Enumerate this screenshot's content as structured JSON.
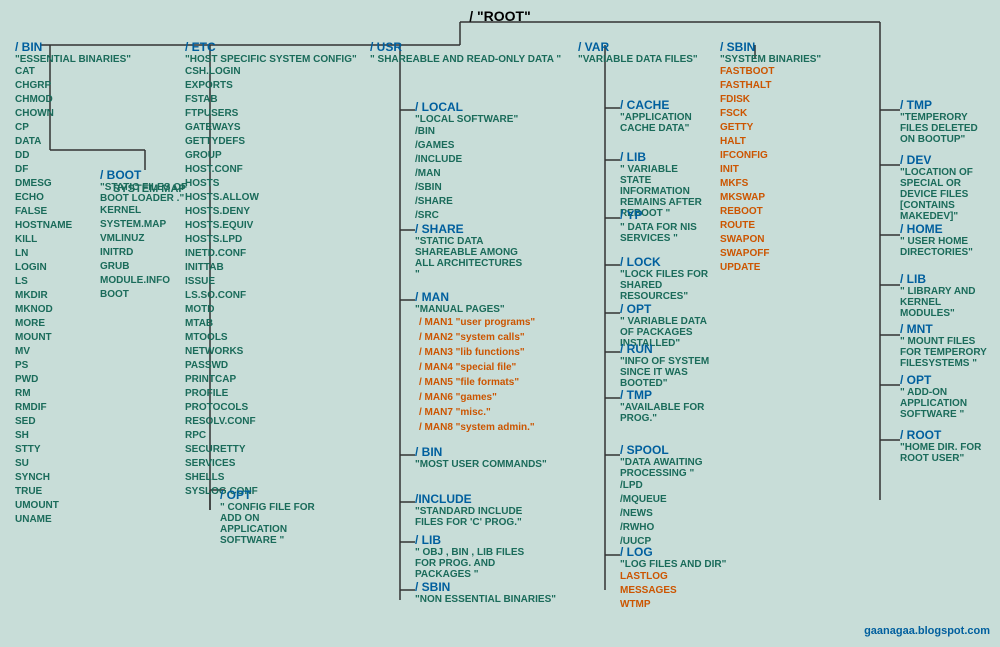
{
  "root": {
    "label": "/   \"ROOT\""
  },
  "bin": {
    "name": "/ BIN",
    "desc": "\"ESSENTIAL BINARIES\"",
    "files": [
      "CAT",
      "CHGRP",
      "CHMOD",
      "CHOWN",
      "CP",
      "DATA",
      "DD",
      "DF",
      "DMESG",
      "ECHO",
      "FALSE",
      "HOSTNAME",
      "KILL",
      "LN",
      "LOGIN",
      "LS",
      "MKDIR",
      "MKNOD",
      "MORE",
      "MOUNT",
      "MV",
      "PS",
      "PWD",
      "RM",
      "RMDIF",
      "SED",
      "SH",
      "STTY",
      "SU",
      "SYNCH",
      "TRUE",
      "UMOUNT",
      "UNAME"
    ]
  },
  "boot": {
    "name": "/ BOOT",
    "desc": "\"STATIC FILES OF BOOT LOADER .\"",
    "files": [
      "KERNEL",
      "SYSTEM.MAP",
      "VMLINUZ",
      "INITRD",
      "GRUB",
      "MODULE.INFO",
      "BOOT"
    ]
  },
  "etc": {
    "name": "/ ETC",
    "desc": "\"HOST SPECIFIC SYSTEM CONFIG\"",
    "files": [
      "CSH.LOGIN",
      "EXPORTS",
      "FSTAB",
      "FTPUSERS",
      "GATEWAYS",
      "GETTYDEFS",
      "GROUP",
      "HOST.CONF",
      "HOSTS",
      "HOSTS.ALLOW",
      "HOSTS.DENY",
      "HOSTS.EQUIV",
      "HOSTS.LPD",
      "INETD.CONF",
      "INITTAB",
      "ISSUE",
      "LS.SO.CONF",
      "MOTD",
      "MTAB",
      "MTOOLS",
      "NETWORKS",
      "PASSWD",
      "PRINTCAP",
      "PROFILE",
      "PROTOCOLS",
      "RESOLV.CONF",
      "RPC",
      "SECURETTY",
      "SERVICES",
      "SHELLS",
      "SYSLOG.CONF"
    ]
  },
  "etc_opt": {
    "name": "/ OPT",
    "desc": "\" CONFIG FILE FOR ADD ON APPLICATION SOFTWARE \""
  },
  "usr": {
    "name": "/ USR",
    "desc": "\" SHAREABLE AND READ-ONLY DATA \""
  },
  "usr_local": {
    "name": "/ LOCAL",
    "desc": "\"LOCAL SOFTWARE\"",
    "subdirs": [
      "/BIN",
      "/GAMES",
      "/INCLUDE",
      "/MAN",
      "/SBIN",
      "/SHARE",
      "/SRC"
    ]
  },
  "usr_share": {
    "name": "/ SHARE",
    "desc": "\"STATIC DATA SHAREABLE AMONG ALL ARCHITECTURES \""
  },
  "usr_man": {
    "name": "/ MAN",
    "desc": "\"MANUAL PAGES\"",
    "subdirs": [
      "/ MAN1 \"user programs\"",
      "/ MAN2 \"system calls\"",
      "/ MAN3 \"lib functions\"",
      "/ MAN4 \"special file\"",
      "/ MAN5 \"file formats\"",
      "/ MAN6 \"games\"",
      "/ MAN7 \"misc.\"",
      "/ MAN8 \"system admin.\""
    ]
  },
  "usr_bin": {
    "name": "/ BIN",
    "desc": "\"MOST USER COMMANDS\""
  },
  "usr_include": {
    "name": "/INCLUDE",
    "desc": "\"STANDARD INCLUDE FILES FOR 'C' PROG.\""
  },
  "usr_lib": {
    "name": "/ LIB",
    "desc": "\" OBJ , BIN , LIB FILES FOR PROG. AND PACKAGES \""
  },
  "usr_sbin": {
    "name": "/ SBIN",
    "desc": "\"NON ESSENTIAL BINARIES\""
  },
  "var": {
    "name": "/ VAR",
    "desc": "\"VARIABLE DATA FILES\""
  },
  "var_cache": {
    "name": "/ CACHE",
    "desc": "\"APPLICATION CACHE DATA\""
  },
  "var_lib": {
    "name": "/ LIB",
    "desc": "\" VARIABLE STATE INFORMATION REMAINS AFTER REBOOT \""
  },
  "var_yp": {
    "name": "/ YP",
    "desc": "\" DATA FOR NIS SERVICES \""
  },
  "var_lock": {
    "name": "/ LOCK",
    "desc": "\"LOCK FILES FOR SHARED RESOURCES\""
  },
  "var_opt": {
    "name": "/ OPT",
    "desc": "\" VARIABLE DATA OF PACKAGES INSTALLED\""
  },
  "var_run": {
    "name": "/ RUN",
    "desc": "\"INFO OF SYSTEM SINCE IT WAS BOOTED\""
  },
  "var_tmp": {
    "name": "/ TMP",
    "desc": "\"AVAILABLE FOR PROG.\""
  },
  "var_spool": {
    "name": "/ SPOOL",
    "desc": "\"DATA AWAITING PROCESSING \"",
    "subdirs": [
      "/LPD",
      "/MQUEUE",
      "/NEWS",
      "/RWHO",
      "/UUCP"
    ]
  },
  "var_log": {
    "name": "/ LOG",
    "desc": "\"LOG FILES AND DIR\"",
    "files_orange": [
      "LASTLOG",
      "MESSAGES",
      "WTMP"
    ]
  },
  "sbin": {
    "name": "/ SBIN",
    "desc": "\"SYSTEM BINARIES\"",
    "files_orange": [
      "FASTBOOT",
      "FASTHALT",
      "FDISK",
      "FSCK",
      "GETTY",
      "HALT",
      "IFCONFIG",
      "INIT",
      "MKFS",
      "MKSWAP",
      "REBOOT",
      "ROUTE",
      "SWAPON",
      "SWAPOFF",
      "UPDATE"
    ]
  },
  "tmp": {
    "name": "/ TMP",
    "desc": "\"TEMPERORY FILES DELETED ON BOOTUP\""
  },
  "dev": {
    "name": "/ DEV",
    "desc": "\"LOCATION OF SPECIAL OR DEVICE FILES [CONTAINS MAKEDEV]\""
  },
  "home": {
    "name": "/ HOME",
    "desc": "\" USER HOME DIRECTORIES\""
  },
  "lib": {
    "name": "/ LIB",
    "desc": "\"  LIBRARY AND KERNEL MODULES\""
  },
  "mnt": {
    "name": "/ MNT",
    "desc": "\"  MOUNT FILES FOR TEMPERORY FILESYSTEMS \""
  },
  "opt": {
    "name": "/ OPT",
    "desc": "\" ADD-ON APPLICATION SOFTWARE \""
  },
  "root_dir": {
    "name": "/ ROOT",
    "desc": "\"HOME DIR. FOR ROOT USER\""
  },
  "watermark": "gaanagaa.blogspot.com",
  "sysmap": "SYSTEM MAP"
}
